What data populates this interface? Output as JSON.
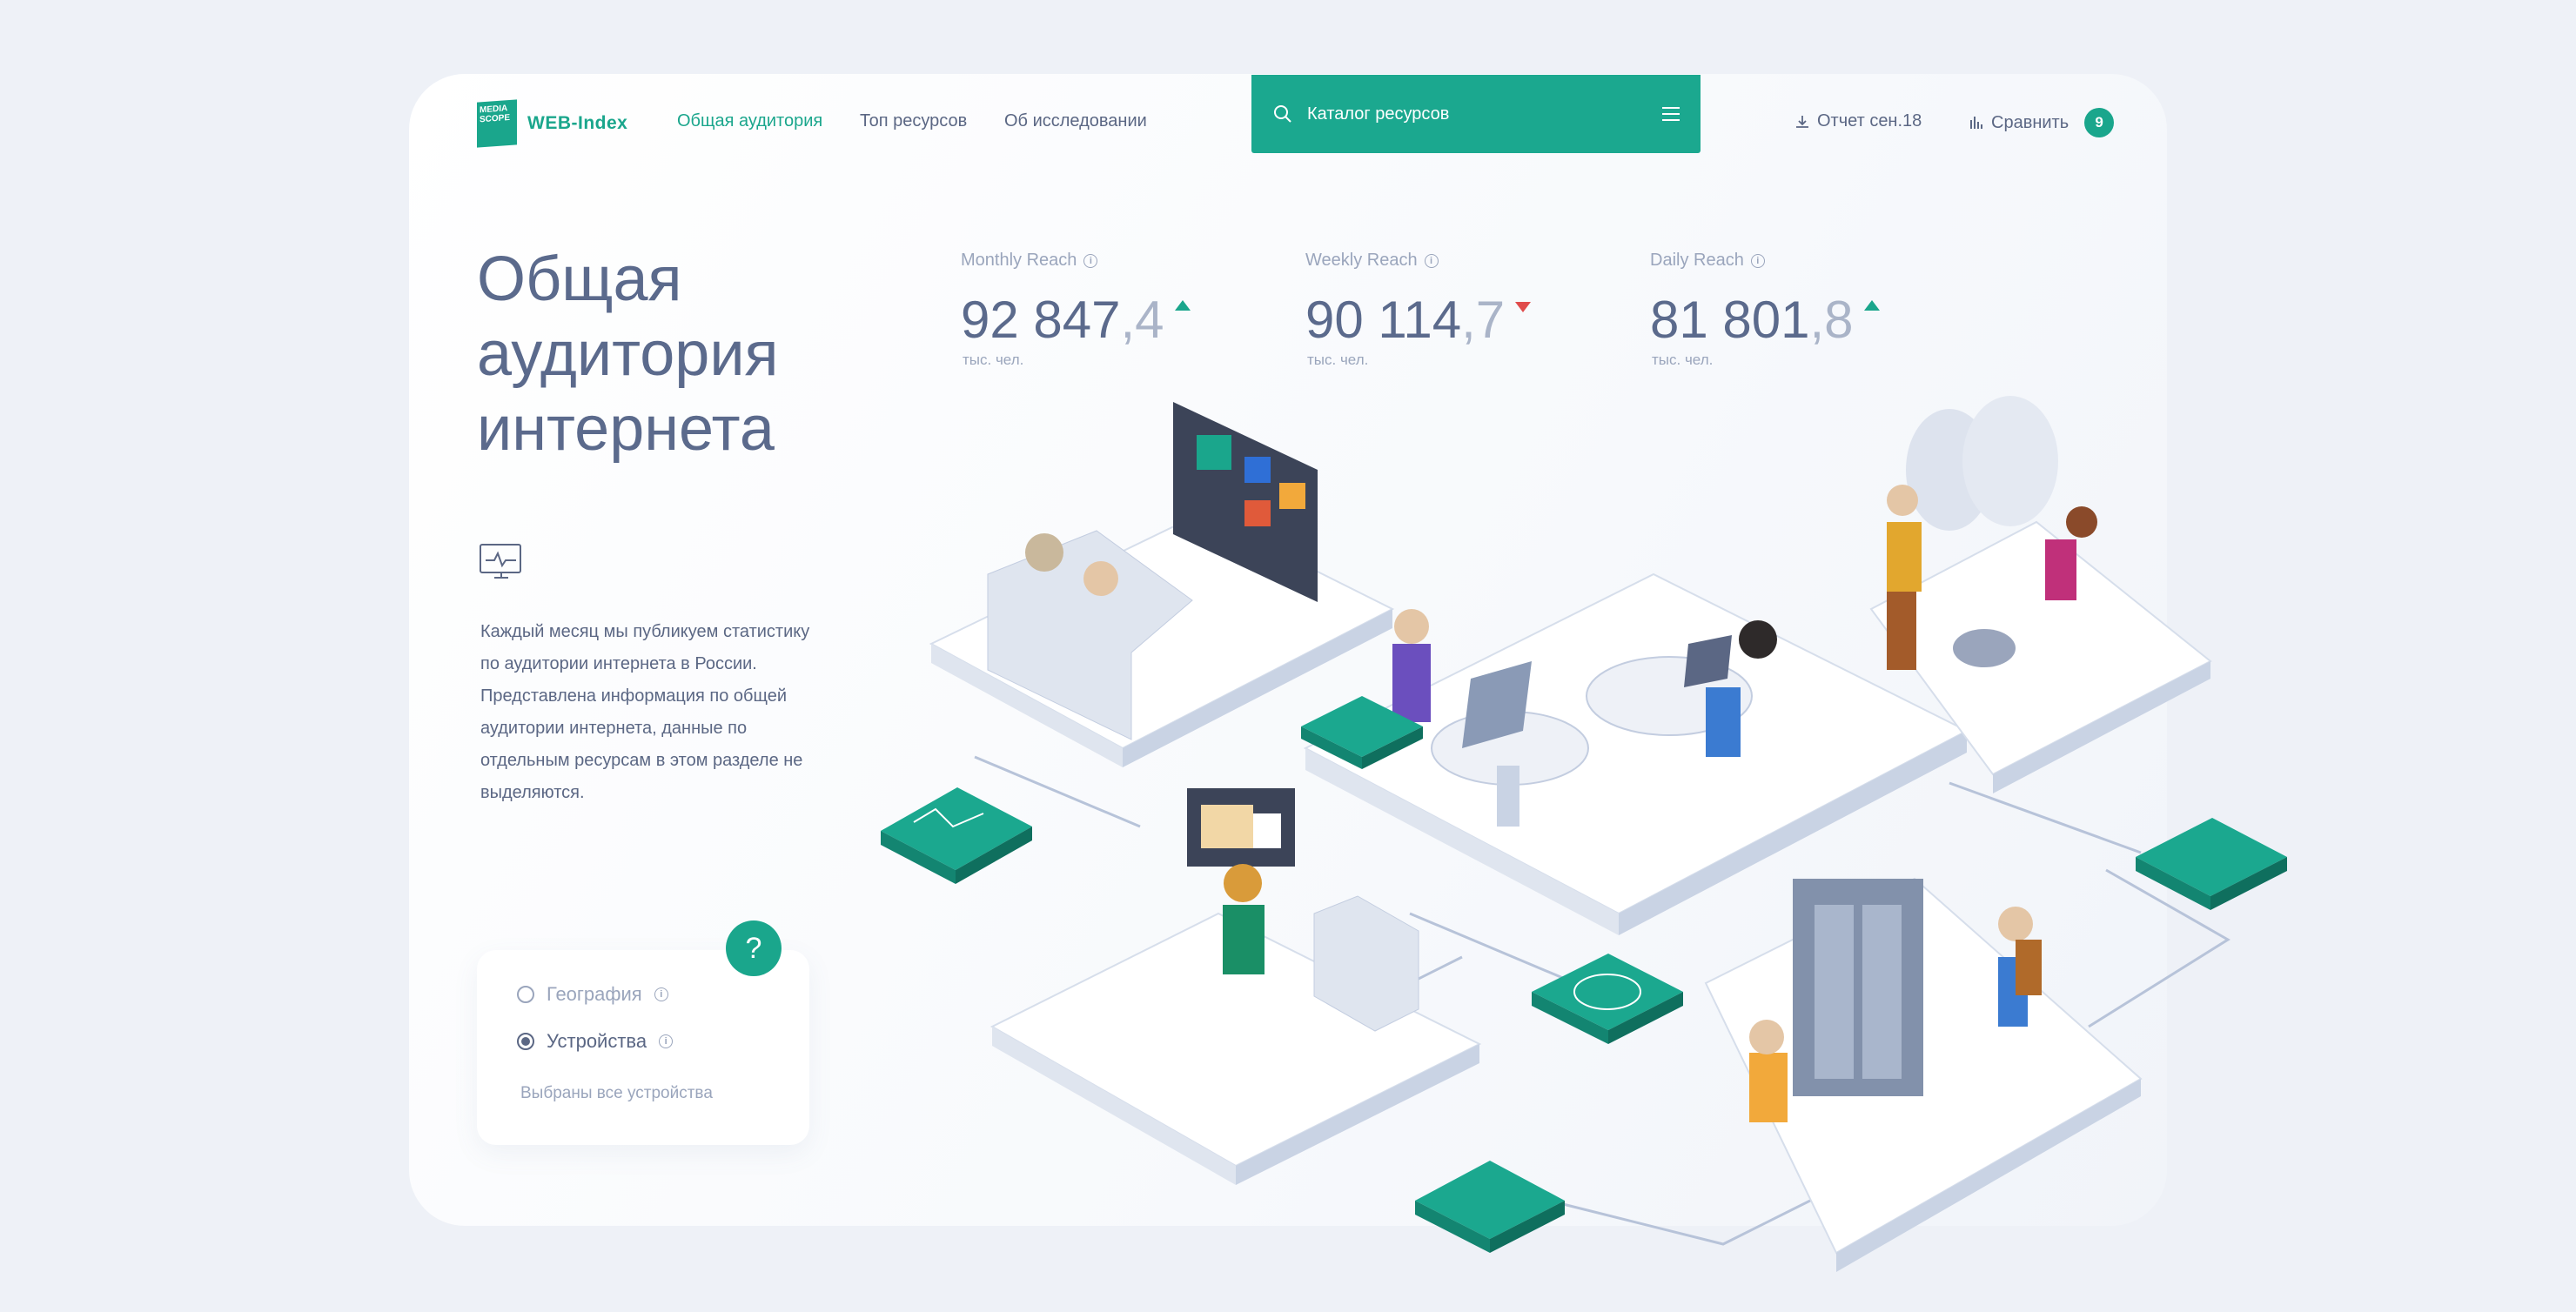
{
  "header": {
    "logo_box": "MEDIA SCOPE",
    "logo_text": "WEB-Index",
    "nav": [
      "Общая аудитория",
      "Топ ресурсов",
      "Об исследовании"
    ],
    "search_placeholder": "Каталог ресурсов",
    "report_label": "Отчет сен.18",
    "compare_label": "Сравнить",
    "compare_count": "9"
  },
  "page": {
    "title": "Общая\nаудитория\nинтернета",
    "description": "Каждый месяц мы публикуем статистику по аудитории интернета в России. Представлена информация по общей аудитории интернета, данные по отдельным ресурсам в этом разделе не выделяются."
  },
  "metrics": [
    {
      "label": "Monthly Reach",
      "int": "92 847",
      "dec": ",4",
      "trend": "up",
      "unit": "тыс. чел."
    },
    {
      "label": "Weekly Reach",
      "int": "90 114",
      "dec": ",7",
      "trend": "down",
      "unit": "тыс. чел."
    },
    {
      "label": "Daily Reach",
      "int": "81 801",
      "dec": ",8",
      "trend": "up",
      "unit": "тыс. чел."
    }
  ],
  "filter": {
    "options": [
      "География",
      "Устройства"
    ],
    "selected": "Устройства",
    "note": "Выбраны все устройства",
    "help": "?"
  },
  "colors": {
    "accent": "#1aa68c",
    "down": "#e04b4b",
    "text": "#5b6784"
  },
  "icons": [
    "search-icon",
    "menu-icon",
    "download-icon",
    "bar-chart-icon",
    "info-icon",
    "monitor-pulse-icon",
    "help-icon"
  ]
}
